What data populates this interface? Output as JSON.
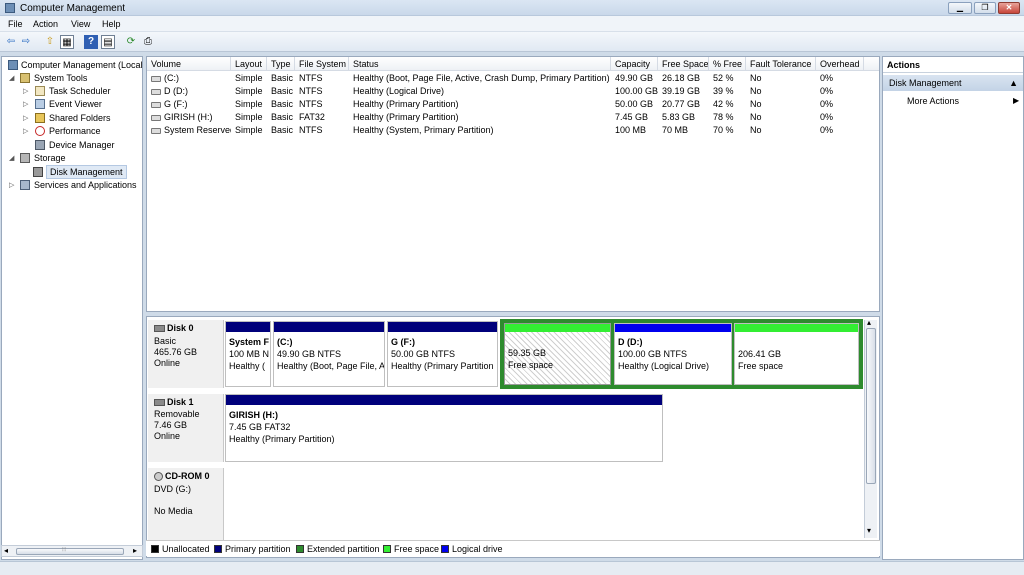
{
  "window": {
    "title": "Computer Management",
    "minimize": "▁",
    "restore": "❐",
    "close": "✕"
  },
  "menu": [
    "File",
    "Action",
    "View",
    "Help"
  ],
  "toolbar": {
    "back": "⇦",
    "forward": "⇨",
    "up": "⇧",
    "show_hide": "▦",
    "help": "?",
    "properties": "▤",
    "refresh": "⟳",
    "export": "⎙"
  },
  "tree": {
    "root": "Computer Management (Local",
    "system_tools": "System Tools",
    "task_scheduler": "Task Scheduler",
    "event_viewer": "Event Viewer",
    "shared_folders": "Shared Folders",
    "performance": "Performance",
    "device_manager": "Device Manager",
    "storage": "Storage",
    "disk_management": "Disk Management",
    "services": "Services and Applications",
    "expand_open": "◢",
    "expand_closed": "▷"
  },
  "volume_table": {
    "headers": [
      "Volume",
      "Layout",
      "Type",
      "File System",
      "Status",
      "Capacity",
      "Free Space",
      "% Free",
      "Fault Tolerance",
      "Overhead"
    ],
    "rows": [
      [
        "(C:)",
        "Simple",
        "Basic",
        "NTFS",
        "Healthy (Boot, Page File, Active, Crash Dump, Primary Partition)",
        "49.90 GB",
        "26.18 GB",
        "52 %",
        "No",
        "0%"
      ],
      [
        "D (D:)",
        "Simple",
        "Basic",
        "NTFS",
        "Healthy (Logical Drive)",
        "100.00 GB",
        "39.19 GB",
        "39 %",
        "No",
        "0%"
      ],
      [
        "G (F:)",
        "Simple",
        "Basic",
        "NTFS",
        "Healthy (Primary Partition)",
        "50.00 GB",
        "20.77 GB",
        "42 %",
        "No",
        "0%"
      ],
      [
        "GIRISH (H:)",
        "Simple",
        "Basic",
        "FAT32",
        "Healthy (Primary Partition)",
        "7.45 GB",
        "5.83 GB",
        "78 %",
        "No",
        "0%"
      ],
      [
        "System Reserved",
        "Simple",
        "Basic",
        "NTFS",
        "Healthy (System, Primary Partition)",
        "100 MB",
        "70 MB",
        "70 %",
        "No",
        "0%"
      ]
    ]
  },
  "disks": {
    "disk0": {
      "name": "Disk 0",
      "type": "Basic",
      "size": "465.76 GB",
      "state": "Online",
      "parts": {
        "sysres": {
          "name": "System F",
          "size": "100 MB N",
          "status": "Healthy ("
        },
        "c": {
          "name": "(C:)",
          "size": "49.90 GB NTFS",
          "status": "Healthy (Boot, Page File, A"
        },
        "g": {
          "name": "G  (F:)",
          "size": "50.00 GB NTFS",
          "status": "Healthy (Primary Partition"
        },
        "free1": {
          "size": "59.35 GB",
          "status": "Free space"
        },
        "d": {
          "name": "D  (D:)",
          "size": "100.00 GB NTFS",
          "status": "Healthy (Logical Drive)"
        },
        "free2": {
          "size": "206.41 GB",
          "status": "Free space"
        }
      }
    },
    "disk1": {
      "name": "Disk 1",
      "type": "Removable",
      "size": "7.46 GB",
      "state": "Online",
      "part": {
        "name": "GIRISH  (H:)",
        "size": "7.45 GB FAT32",
        "status": "Healthy (Primary Partition)"
      }
    },
    "cdrom0": {
      "name": "CD-ROM 0",
      "type": "DVD (G:)",
      "state": "No Media"
    }
  },
  "legend": [
    {
      "label": "Unallocated",
      "color": "#000000"
    },
    {
      "label": "Primary partition",
      "color": "#00007b"
    },
    {
      "label": "Extended partition",
      "color": "#2e8b2e"
    },
    {
      "label": "Free space",
      "color": "#33ee33"
    },
    {
      "label": "Logical drive",
      "color": "#0000ee"
    }
  ],
  "actions": {
    "header": "Actions",
    "section": "Disk Management",
    "section_arrow": "▲",
    "more": "More Actions",
    "more_arrow": "▶"
  },
  "scroll": {
    "left": "◂",
    "grip": "⦙⦙⦙",
    "right": "▸",
    "up": "▴",
    "down": "▾"
  }
}
